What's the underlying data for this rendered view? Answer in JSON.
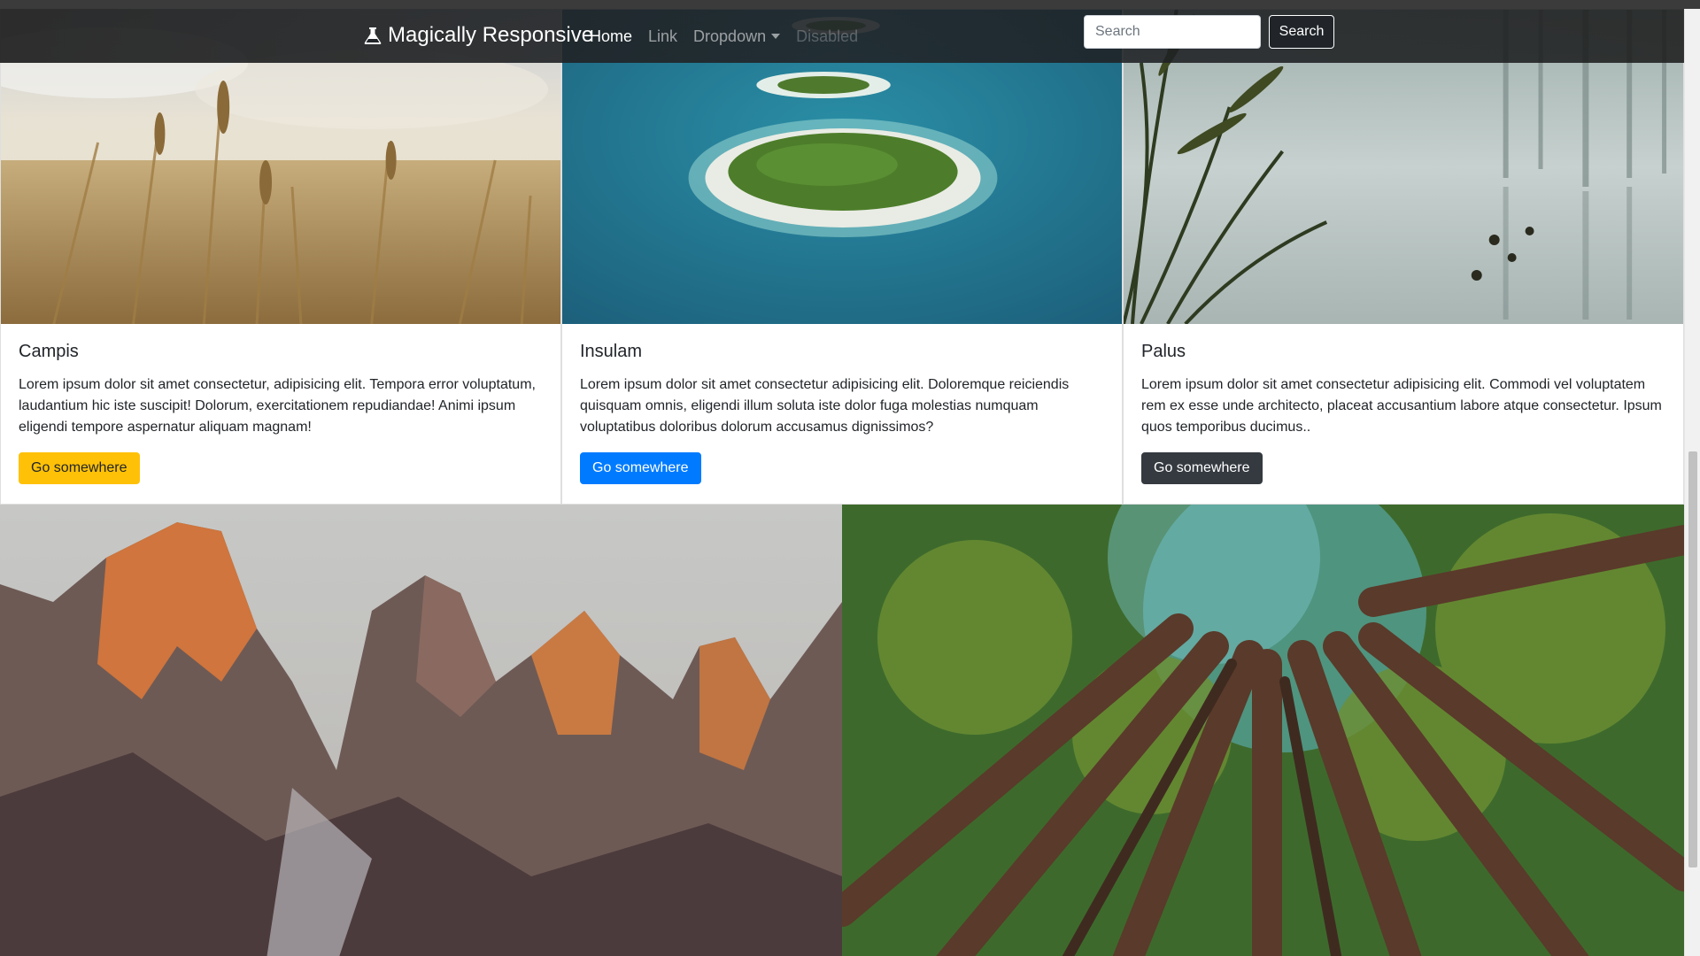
{
  "navbar": {
    "brand": "Magically Responsive",
    "brand_icon": "flask-icon",
    "links": [
      {
        "label": "Home",
        "state": "active"
      },
      {
        "label": "Link",
        "state": "normal"
      },
      {
        "label": "Dropdown",
        "state": "dropdown"
      },
      {
        "label": "Disabled",
        "state": "disabled"
      }
    ],
    "search_placeholder": "Search",
    "search_button": "Search"
  },
  "cards": [
    {
      "title": "Campis",
      "text": "Lorem ipsum dolor sit amet consectetur, adipisicing elit. Tempora error voluptatum, laudantium hic iste suscipit! Dolorum, exercitationem repudiandae! Animi ipsum eligendi tempore aspernatur aliquam magnam!",
      "button": "Go somewhere",
      "button_style": "warning",
      "image": "wheat-field-photo"
    },
    {
      "title": "Insulam",
      "text": "Lorem ipsum dolor sit amet consectetur adipisicing elit. Doloremque reiciendis quisquam omnis, eligendi illum soluta iste dolor fuga molestias numquam voluptatibus doloribus dolorum accusamus dignissimos?",
      "button": "Go somewhere",
      "button_style": "primary",
      "image": "island-aerial-photo"
    },
    {
      "title": "Palus",
      "text": "Lorem ipsum dolor sit amet consectetur adipisicing elit. Commodi vel voluptatem rem ex esse unde architecto, placeat accusantium labore atque consectetur. Ipsum quos temporibus ducimus..",
      "button": "Go somewhere",
      "button_style": "dark",
      "image": "misty-swamp-photo"
    }
  ],
  "bottom_images": [
    "mountains-photo",
    "forest-canopy-photo"
  ],
  "colors": {
    "warning": "#ffc107",
    "primary": "#007bff",
    "dark": "#343a40",
    "navbar": "#212529"
  }
}
